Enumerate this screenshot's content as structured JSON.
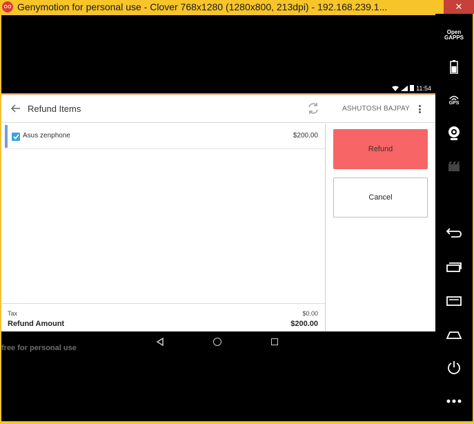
{
  "window": {
    "title": "Genymotion for personal use - Clover 768x1280 (1280x800, 213dpi) - 192.168.239.1...",
    "app_icon": "oo",
    "close_label": "✕"
  },
  "status_bar": {
    "time": "11:54"
  },
  "toolbar": {
    "title": "Refund Items",
    "user_name": "ASHUTOSH BAJPAY"
  },
  "items": [
    {
      "name": "Asus zenphone",
      "price": "$200.00",
      "checked": true
    }
  ],
  "totals": {
    "tax_label": "Tax",
    "tax_value": "$0.00",
    "refund_label": "Refund Amount",
    "refund_value": "$200.00"
  },
  "actions": {
    "refund_label": "Refund",
    "cancel_label": "Cancel"
  },
  "watermark": "free for personal use",
  "sidebar": {
    "gapps_line1": "Open",
    "gapps_line2": "GAPPS",
    "gps_label": "GPS"
  },
  "colors": {
    "refund_button": "#f76566",
    "checkbox": "#3fa2dc",
    "item_accent": "#7b9bd6",
    "title_bar": "#f7c52a"
  }
}
